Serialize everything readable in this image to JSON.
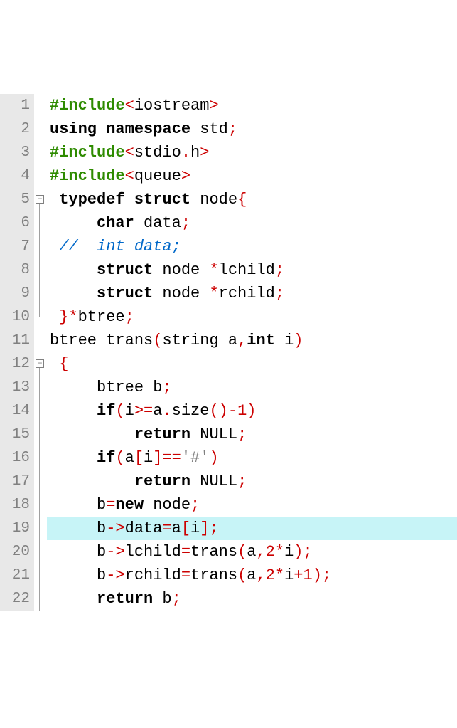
{
  "editor": {
    "highlighted_line": 19,
    "lines": [
      {
        "num": "1",
        "fold": "",
        "tokens": [
          [
            "pp",
            "#include"
          ],
          [
            "op",
            "<"
          ],
          [
            "id",
            "iostream"
          ],
          [
            "op",
            ">"
          ]
        ]
      },
      {
        "num": "2",
        "fold": "",
        "tokens": [
          [
            "kw",
            "using"
          ],
          [
            "id",
            " "
          ],
          [
            "kw",
            "namespace"
          ],
          [
            "id",
            " std"
          ],
          [
            "op",
            ";"
          ]
        ]
      },
      {
        "num": "3",
        "fold": "",
        "tokens": [
          [
            "pp",
            "#include"
          ],
          [
            "op",
            "<"
          ],
          [
            "id",
            "stdio"
          ],
          [
            "op",
            "."
          ],
          [
            "id",
            "h"
          ],
          [
            "op",
            ">"
          ]
        ]
      },
      {
        "num": "4",
        "fold": "",
        "tokens": [
          [
            "pp",
            "#include"
          ],
          [
            "op",
            "<"
          ],
          [
            "id",
            "queue"
          ],
          [
            "op",
            ">"
          ]
        ]
      },
      {
        "num": "5",
        "fold": "box",
        "tokens": [
          [
            "id",
            " "
          ],
          [
            "kw",
            "typedef"
          ],
          [
            "id",
            " "
          ],
          [
            "kw",
            "struct"
          ],
          [
            "id",
            " node"
          ],
          [
            "op",
            "{"
          ]
        ]
      },
      {
        "num": "6",
        "fold": "line",
        "tokens": [
          [
            "id",
            "     "
          ],
          [
            "kw",
            "char"
          ],
          [
            "id",
            " data"
          ],
          [
            "op",
            ";"
          ]
        ]
      },
      {
        "num": "7",
        "fold": "line",
        "tokens": [
          [
            "cm",
            " //  int data;"
          ]
        ]
      },
      {
        "num": "8",
        "fold": "line",
        "tokens": [
          [
            "id",
            "     "
          ],
          [
            "kw",
            "struct"
          ],
          [
            "id",
            " node "
          ],
          [
            "op",
            "*"
          ],
          [
            "id",
            "lchild"
          ],
          [
            "op",
            ";"
          ]
        ]
      },
      {
        "num": "9",
        "fold": "line",
        "tokens": [
          [
            "id",
            "     "
          ],
          [
            "kw",
            "struct"
          ],
          [
            "id",
            " node "
          ],
          [
            "op",
            "*"
          ],
          [
            "id",
            "rchild"
          ],
          [
            "op",
            ";"
          ]
        ]
      },
      {
        "num": "10",
        "fold": "end",
        "tokens": [
          [
            "id",
            " "
          ],
          [
            "op",
            "}*"
          ],
          [
            "id",
            "btree"
          ],
          [
            "op",
            ";"
          ]
        ]
      },
      {
        "num": "11",
        "fold": "",
        "tokens": [
          [
            "id",
            "btree trans"
          ],
          [
            "op",
            "("
          ],
          [
            "id",
            "string a"
          ],
          [
            "op",
            ","
          ],
          [
            "kw",
            "int"
          ],
          [
            "id",
            " i"
          ],
          [
            "op",
            ")"
          ]
        ]
      },
      {
        "num": "12",
        "fold": "box",
        "tokens": [
          [
            "id",
            " "
          ],
          [
            "op",
            "{"
          ]
        ]
      },
      {
        "num": "13",
        "fold": "line",
        "tokens": [
          [
            "id",
            "     btree b"
          ],
          [
            "op",
            ";"
          ]
        ]
      },
      {
        "num": "14",
        "fold": "line",
        "tokens": [
          [
            "id",
            "     "
          ],
          [
            "kw",
            "if"
          ],
          [
            "op",
            "("
          ],
          [
            "id",
            "i"
          ],
          [
            "op",
            ">="
          ],
          [
            "id",
            "a"
          ],
          [
            "op",
            "."
          ],
          [
            "id",
            "size"
          ],
          [
            "op",
            "()-"
          ],
          [
            "num",
            "1"
          ],
          [
            "op",
            ")"
          ]
        ]
      },
      {
        "num": "15",
        "fold": "line",
        "tokens": [
          [
            "id",
            "         "
          ],
          [
            "kw",
            "return"
          ],
          [
            "id",
            " NULL"
          ],
          [
            "op",
            ";"
          ]
        ]
      },
      {
        "num": "16",
        "fold": "line",
        "tokens": [
          [
            "id",
            "     "
          ],
          [
            "kw",
            "if"
          ],
          [
            "op",
            "("
          ],
          [
            "id",
            "a"
          ],
          [
            "op",
            "["
          ],
          [
            "id",
            "i"
          ],
          [
            "op",
            "]=="
          ],
          [
            "ch",
            "'#'"
          ],
          [
            "op",
            ")"
          ]
        ]
      },
      {
        "num": "17",
        "fold": "line",
        "tokens": [
          [
            "id",
            "         "
          ],
          [
            "kw",
            "return"
          ],
          [
            "id",
            " NULL"
          ],
          [
            "op",
            ";"
          ]
        ]
      },
      {
        "num": "18",
        "fold": "line",
        "tokens": [
          [
            "id",
            "     b"
          ],
          [
            "op",
            "="
          ],
          [
            "kw",
            "new"
          ],
          [
            "id",
            " node"
          ],
          [
            "op",
            ";"
          ]
        ]
      },
      {
        "num": "19",
        "fold": "line",
        "tokens": [
          [
            "id",
            "     b"
          ],
          [
            "op",
            "->"
          ],
          [
            "id",
            "data"
          ],
          [
            "op",
            "="
          ],
          [
            "id",
            "a"
          ],
          [
            "op",
            "["
          ],
          [
            "id",
            "i"
          ],
          [
            "op",
            "];"
          ]
        ]
      },
      {
        "num": "20",
        "fold": "line",
        "tokens": [
          [
            "id",
            "     b"
          ],
          [
            "op",
            "->"
          ],
          [
            "id",
            "lchild"
          ],
          [
            "op",
            "="
          ],
          [
            "id",
            "trans"
          ],
          [
            "op",
            "("
          ],
          [
            "id",
            "a"
          ],
          [
            "op",
            ","
          ],
          [
            "num",
            "2"
          ],
          [
            "op",
            "*"
          ],
          [
            "id",
            "i"
          ],
          [
            "op",
            ");"
          ]
        ]
      },
      {
        "num": "21",
        "fold": "line",
        "tokens": [
          [
            "id",
            "     b"
          ],
          [
            "op",
            "->"
          ],
          [
            "id",
            "rchild"
          ],
          [
            "op",
            "="
          ],
          [
            "id",
            "trans"
          ],
          [
            "op",
            "("
          ],
          [
            "id",
            "a"
          ],
          [
            "op",
            ","
          ],
          [
            "num",
            "2"
          ],
          [
            "op",
            "*"
          ],
          [
            "id",
            "i"
          ],
          [
            "op",
            "+"
          ],
          [
            "num",
            "1"
          ],
          [
            "op",
            ");"
          ]
        ]
      },
      {
        "num": "22",
        "fold": "line",
        "tokens": [
          [
            "id",
            "     "
          ],
          [
            "kw",
            "return"
          ],
          [
            "id",
            " b"
          ],
          [
            "op",
            ";"
          ]
        ]
      }
    ]
  },
  "fold_minus": "−"
}
